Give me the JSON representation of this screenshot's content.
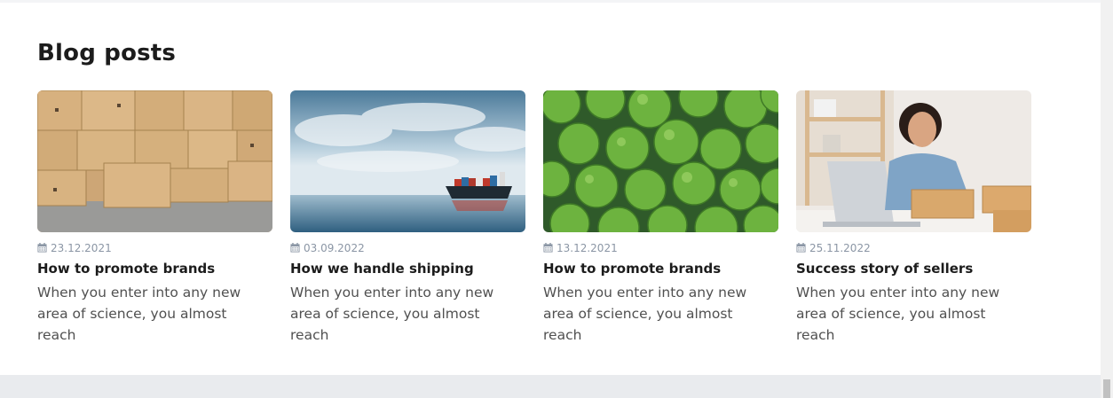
{
  "section": {
    "title": "Blog posts"
  },
  "posts": [
    {
      "date": "23.12.2021",
      "title": "How to promote brands",
      "excerpt": "When you enter into any new area of science, you almost reach",
      "image": "cardboard-boxes-warehouse"
    },
    {
      "date": "03.09.2022",
      "title": "How we handle shipping",
      "excerpt": "When you enter into any new area of science, you almost reach",
      "image": "cargo-ship-at-sea"
    },
    {
      "date": "13.12.2021",
      "title": "How to promote brands",
      "excerpt": "When you enter into any new area of science, you almost reach",
      "image": "limes"
    },
    {
      "date": "25.11.2022",
      "title": "Success story of sellers",
      "excerpt": "When you enter into any new area of science, you almost reach",
      "image": "woman-with-parcels-at-laptop"
    }
  ],
  "icons": {
    "date": "calendar-icon"
  },
  "colors": {
    "title": "#1c1c1c",
    "date": "#8b96a5",
    "text": "#505050",
    "footer": "#e9ebee"
  }
}
